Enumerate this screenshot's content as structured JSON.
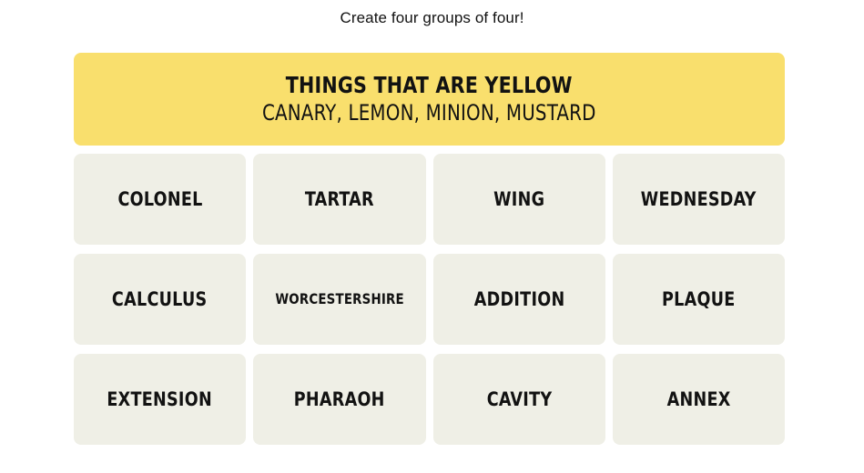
{
  "header": {
    "instruction": "Create four groups of four!"
  },
  "colors": {
    "page_background": "#FFFFFF",
    "tile_background": "#EFEFE6",
    "text": "#121212",
    "group_yellow": "#F9DF6D"
  },
  "solved_groups": [
    {
      "title": "THINGS THAT ARE YELLOW",
      "members": "CANARY, LEMON, MINION, MUSTARD",
      "color": "#F9DF6D",
      "difficulty": "yellow"
    }
  ],
  "grid": {
    "columns": 4,
    "rows": [
      [
        {
          "label": "COLONEL",
          "size": "normal"
        },
        {
          "label": "TARTAR",
          "size": "normal"
        },
        {
          "label": "WING",
          "size": "normal"
        },
        {
          "label": "WEDNESDAY",
          "size": "normal"
        }
      ],
      [
        {
          "label": "CALCULUS",
          "size": "normal"
        },
        {
          "label": "WORCESTERSHIRE",
          "size": "small"
        },
        {
          "label": "ADDITION",
          "size": "normal"
        },
        {
          "label": "PLAQUE",
          "size": "normal"
        }
      ],
      [
        {
          "label": "EXTENSION",
          "size": "normal"
        },
        {
          "label": "PHARAOH",
          "size": "normal"
        },
        {
          "label": "CAVITY",
          "size": "normal"
        },
        {
          "label": "ANNEX",
          "size": "normal"
        }
      ]
    ]
  }
}
